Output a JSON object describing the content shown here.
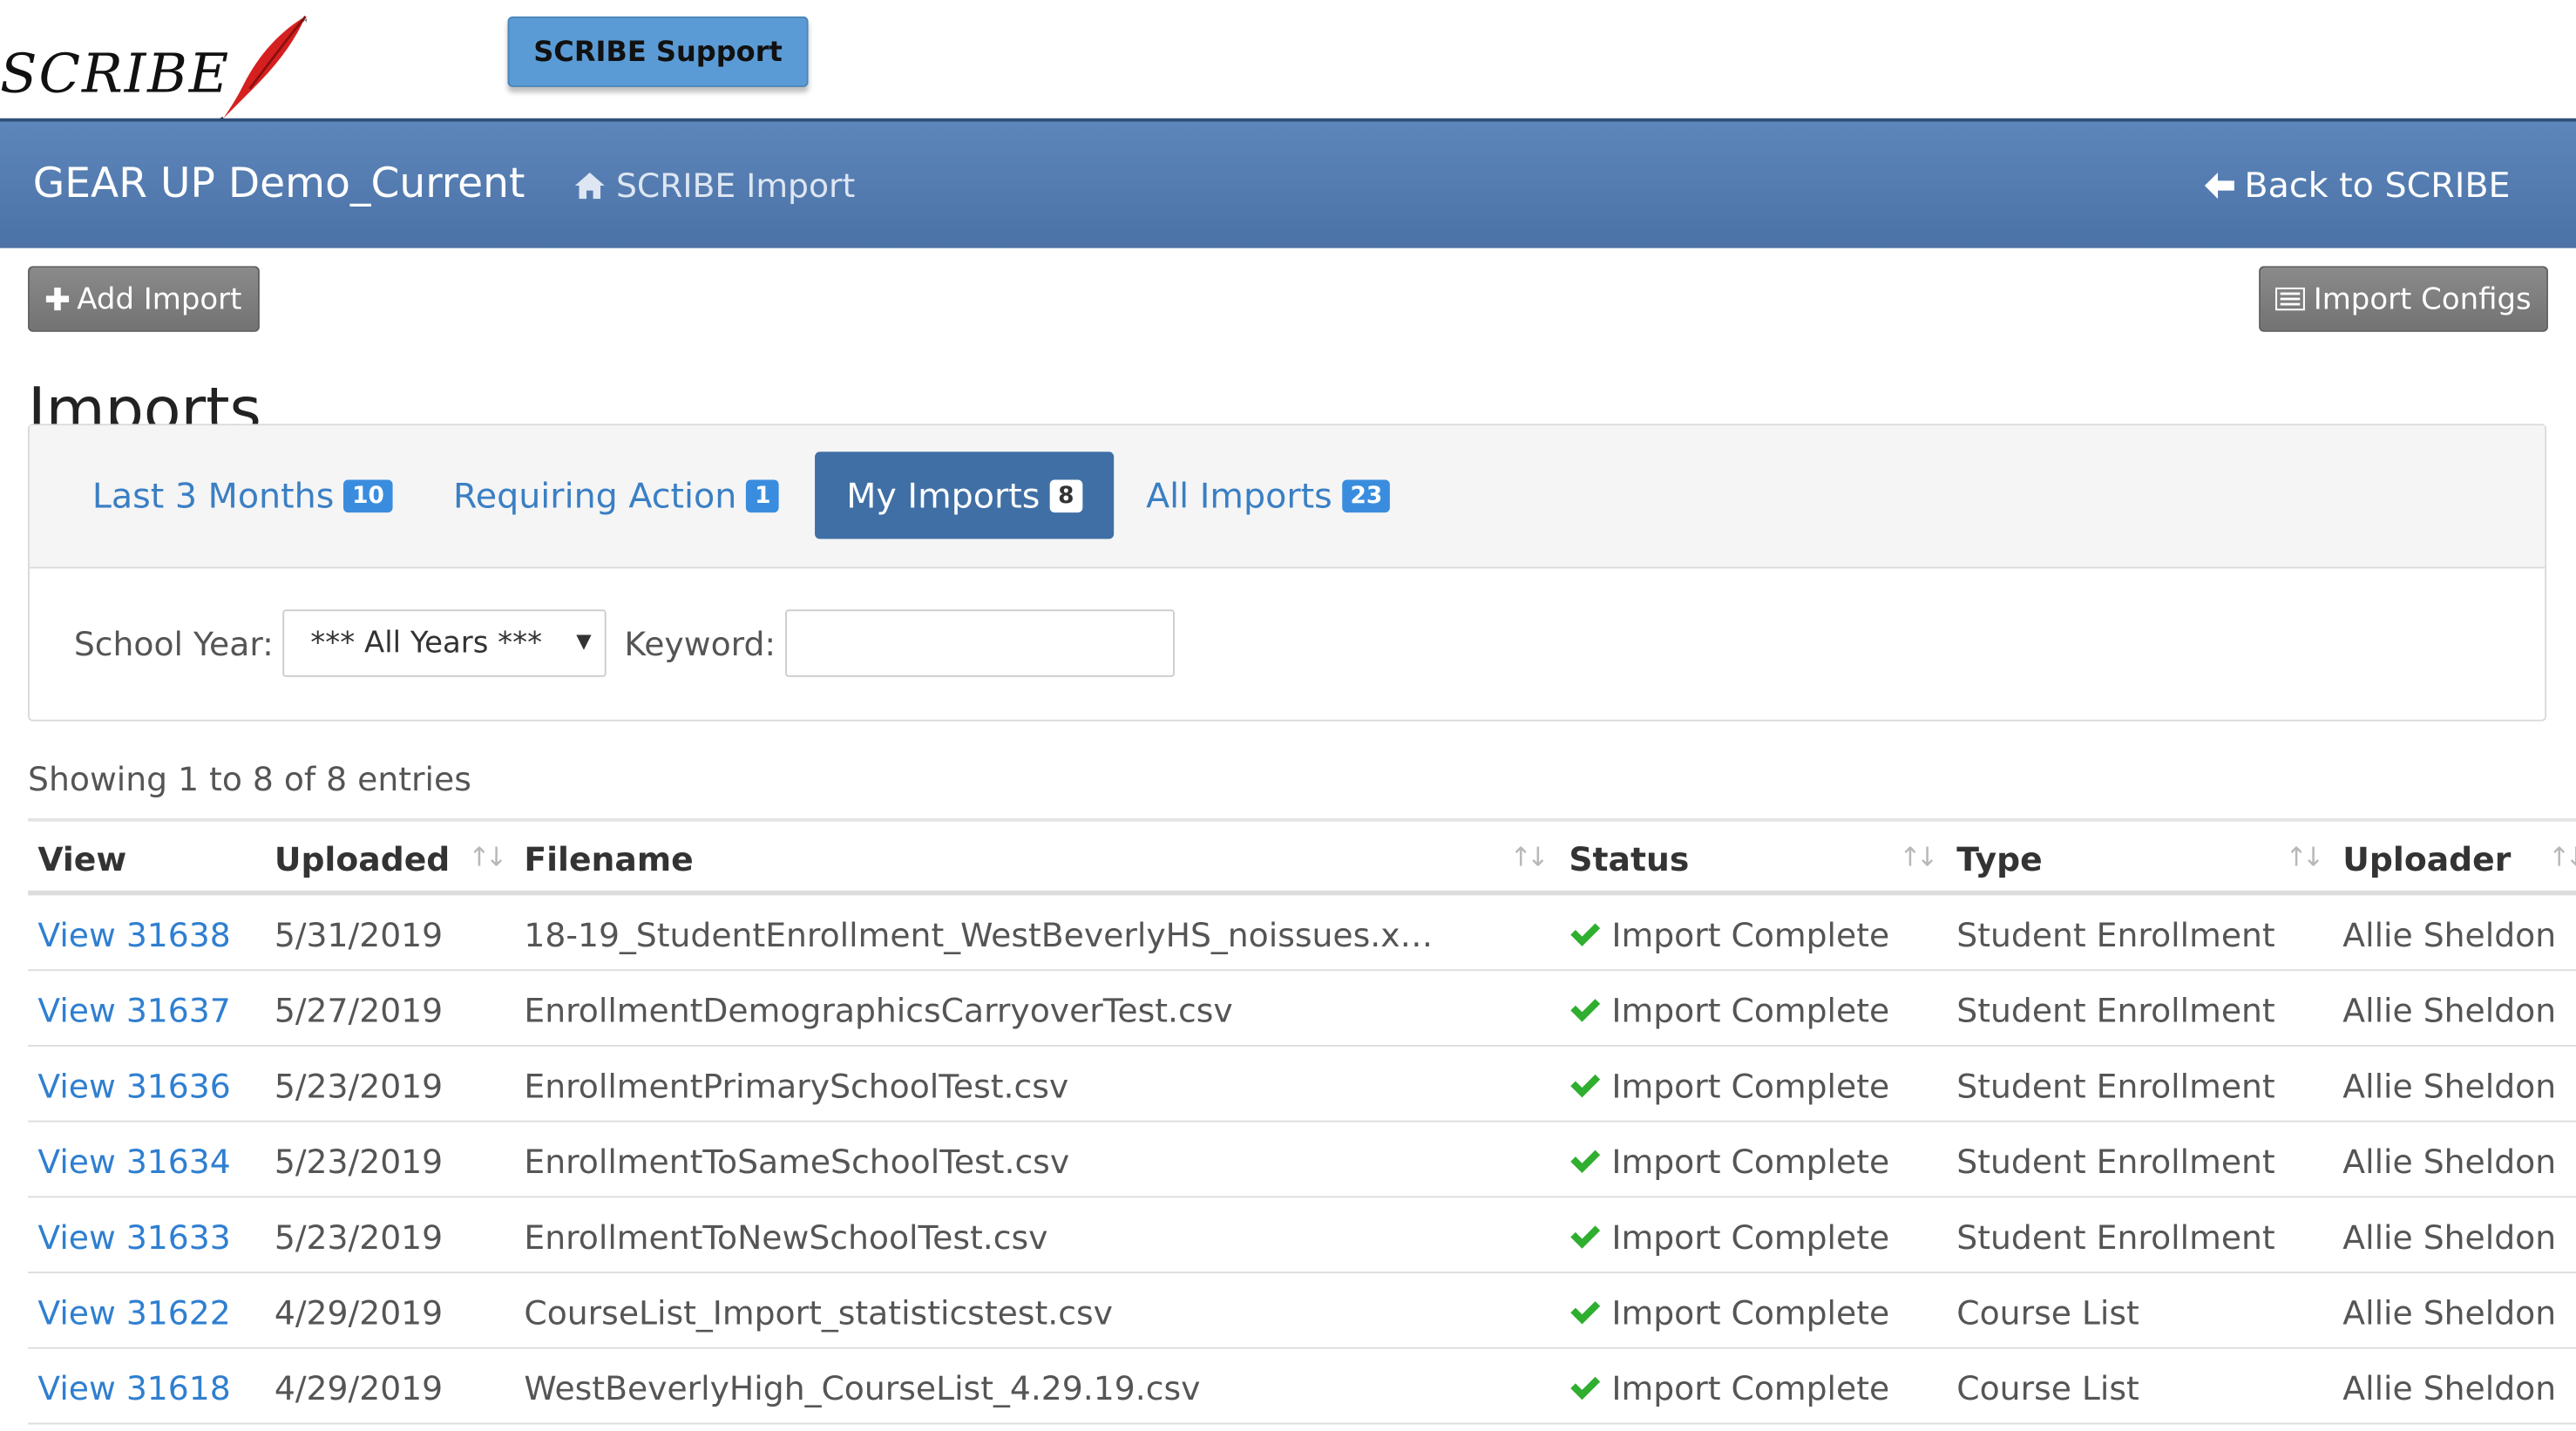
{
  "brand": {
    "logo_text": "SCRIBE",
    "logo_tm": "™",
    "support_button": "SCRIBE Support"
  },
  "header": {
    "title": "GEAR UP Demo_Current",
    "breadcrumb_icon": "home-icon",
    "breadcrumb": "SCRIBE Import",
    "back_icon": "arrow-left-icon",
    "back_link": "Back to SCRIBE"
  },
  "actions": {
    "add_icon": "plus-icon",
    "add_import": "Add Import",
    "configs_icon": "list-icon",
    "import_configs": "Import Configs"
  },
  "page": {
    "title": "Imports"
  },
  "tabs": [
    {
      "label": "Last 3 Months",
      "count": "10",
      "active": false
    },
    {
      "label": "Requiring Action",
      "count": "1",
      "active": false
    },
    {
      "label": "My Imports",
      "count": "8",
      "active": true
    },
    {
      "label": "All Imports",
      "count": "23",
      "active": false
    }
  ],
  "filters": {
    "school_year_label": "School Year:",
    "school_year_value": "*** All Years ***",
    "keyword_label": "Keyword:",
    "keyword_value": ""
  },
  "table": {
    "info": "Showing 1 to 8 of 8 entries",
    "columns": [
      "View",
      "Uploaded",
      "Filename",
      "Status",
      "Type",
      "Uploader"
    ],
    "rows": [
      {
        "view": "View 31638",
        "uploaded": "5/31/2019",
        "filename": "18-19_StudentEnrollment_WestBeverlyHS_noissues.xl...",
        "status": "Import Complete",
        "type": "Student Enrollment",
        "uploader": "Allie Sheldon"
      },
      {
        "view": "View 31637",
        "uploaded": "5/27/2019",
        "filename": "EnrollmentDemographicsCarryoverTest.csv",
        "status": "Import Complete",
        "type": "Student Enrollment",
        "uploader": "Allie Sheldon"
      },
      {
        "view": "View 31636",
        "uploaded": "5/23/2019",
        "filename": "EnrollmentPrimarySchoolTest.csv",
        "status": "Import Complete",
        "type": "Student Enrollment",
        "uploader": "Allie Sheldon"
      },
      {
        "view": "View 31634",
        "uploaded": "5/23/2019",
        "filename": "EnrollmentToSameSchoolTest.csv",
        "status": "Import Complete",
        "type": "Student Enrollment",
        "uploader": "Allie Sheldon"
      },
      {
        "view": "View 31633",
        "uploaded": "5/23/2019",
        "filename": "EnrollmentToNewSchoolTest.csv",
        "status": "Import Complete",
        "type": "Student Enrollment",
        "uploader": "Allie Sheldon"
      },
      {
        "view": "View 31622",
        "uploaded": "4/29/2019",
        "filename": "CourseList_Import_statisticstest.csv",
        "status": "Import Complete",
        "type": "Course List",
        "uploader": "Allie Sheldon"
      },
      {
        "view": "View 31618",
        "uploaded": "4/29/2019",
        "filename": "WestBeverlyHigh_CourseList_4.29.19.csv",
        "status": "Import Complete",
        "type": "Course List",
        "uploader": "Allie Sheldon"
      }
    ]
  },
  "colors": {
    "header_blue": "#4b72a6",
    "support_blue": "#5b9bd5",
    "link_blue": "#2f7fd0",
    "active_tab": "#3f6fa5",
    "badge_blue": "#3a8dde",
    "success_green": "#2fae2f",
    "quill_red": "#d62020"
  }
}
